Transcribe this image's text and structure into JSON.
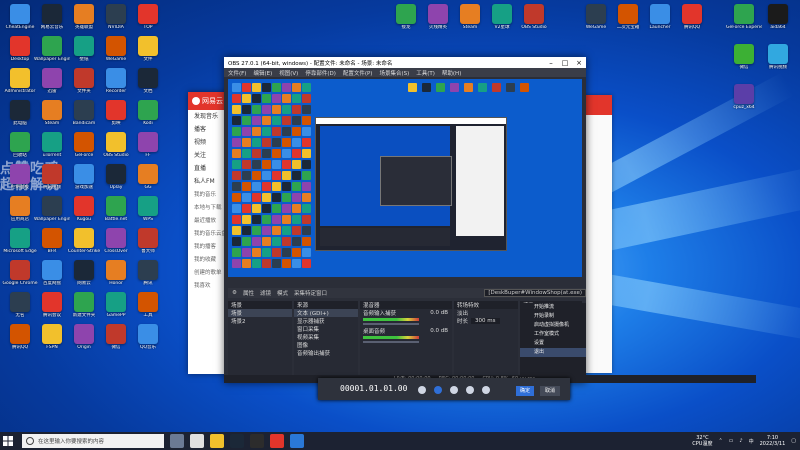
{
  "desktop": {
    "icons_col1": [
      "CheatEngine",
      "Desktop",
      "Administrator",
      "此电脑",
      "回收站",
      "控制面板",
      "应用商店",
      "Microsoft Edge",
      "Google Chrome",
      "无名",
      "腾讯QQ"
    ],
    "icons_col2": [
      "网易云音乐",
      "Wallpaper Engine",
      "迅雷",
      "Steam",
      "uTorrent",
      "腾讯视频",
      "Wallpaper Engine",
      "BFR",
      "百度网盘",
      "腾讯会议",
      "FSPN"
    ],
    "icons_col3": [
      "英雄联盟",
      "壁纸",
      "文件夹",
      "Bandicam",
      "GeForce",
      "游戏加速",
      "Kugou",
      "Counter-Strike",
      "网易云",
      "新建文件夹",
      "Origin"
    ],
    "icons_col4": [
      "NVIDIA",
      "WeGame",
      "Recorder",
      "剪映",
      "OBS Studio",
      "Uplay",
      "Battle.net",
      "CrossOver",
      "Honor",
      "GamePP",
      "微信"
    ],
    "icons_col5": [
      "TOP",
      "文件",
      "文档",
      "Kodi",
      "FF",
      "GG",
      "WPS",
      "鲁大师",
      "腾讯",
      "工具",
      "QQ音乐"
    ],
    "top_icons": [
      "接龙",
      "火线精英",
      "Steam",
      "V2星球",
      "OBS Studio",
      "WeGame",
      "二次元宝箱",
      "Launcher",
      "腾讯QQ"
    ],
    "right_icons": [
      "GeForce Experience",
      "aida64",
      "微信",
      "腾讯视频",
      "cpuz_x64"
    ],
    "watermark": "点赞吃鸡\n超前解说"
  },
  "netease": {
    "title": "网易云",
    "nav": [
      "发现音乐",
      "播客",
      "视频",
      "关注",
      "直播",
      "私人FM",
      "我的音乐",
      "本地与下载",
      "最近播放",
      "我的音乐云盘",
      "我的播客",
      "我的收藏",
      "创建的歌单",
      "我喜欢"
    ]
  },
  "obs": {
    "title": "OBS 27.0.1 (64-bit, windows) - 配置文件: 未命名 - 场景: 未命名",
    "menu": [
      "文件(F)",
      "编辑(E)",
      "视图(V)",
      "停靠部件(D)",
      "配置文件(P)",
      "场景集合(S)",
      "工具(T)",
      "帮助(H)"
    ],
    "toolbar": {
      "props": "属性",
      "filters": "滤镜",
      "mode": "模式",
      "capture": "采集特定窗口",
      "source": "[DeskBuper#WindowShop(at.exe)"
    },
    "scenes_header": "场景",
    "scenes": [
      "场景",
      "场景2"
    ],
    "sources_header": "来源",
    "sources": [
      "文本 (GDI+)",
      "显示器捕获",
      "窗口采集",
      "视频采集",
      "图像",
      "音频输出捕获"
    ],
    "mixer_header": "混音器",
    "mixer": [
      {
        "label": "音频输入捕获",
        "db": "0.0 dB"
      },
      {
        "label": "桌面音频",
        "db": "0.0 dB"
      }
    ],
    "transitions_header": "转场特效",
    "transition": {
      "name": "淡出",
      "duration_label": "时长",
      "duration": "300 ms"
    },
    "controls_header": "控件",
    "controls": [
      "开始推流",
      "开始录制",
      "启动虚拟摄像机",
      "工作室模式",
      "设置",
      "退出"
    ],
    "status": {
      "live": "LIVE: 00:00:00",
      "rec": "REC: 00:00:00",
      "cpu": "CPU: 0.8%, 60.00 fps"
    }
  },
  "player": {
    "time": "00001.01.01.00",
    "btn1": "确定",
    "btn2": "取消"
  },
  "context_menu": [
    "开始推流",
    "开始录制",
    "启动虚拟摄像机",
    "工作室模式",
    "设置",
    "退出"
  ],
  "taskbar": {
    "search_placeholder": "在这里输入你要搜索的内容",
    "weather": "32°C",
    "weather_desc": "CPU温度",
    "time": "7:10",
    "date": "2022/3/11"
  },
  "colors": {
    "accent_red": "#e2352b",
    "obs_bg": "#2b2e38",
    "desktop": "#0a4fc8"
  }
}
